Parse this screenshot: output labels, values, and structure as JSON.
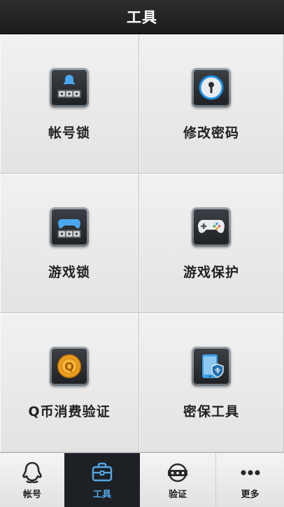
{
  "header": {
    "title": "工具"
  },
  "tools": [
    {
      "label": "帐号锁",
      "icon": "account-lock-icon"
    },
    {
      "label": "修改密码",
      "icon": "change-password-icon"
    },
    {
      "label": "游戏锁",
      "icon": "game-lock-icon"
    },
    {
      "label": "游戏保护",
      "icon": "game-protect-icon"
    },
    {
      "label": "Q币消费验证",
      "icon": "qcoin-verify-icon"
    },
    {
      "label": "密保工具",
      "icon": "security-tool-icon"
    }
  ],
  "tabs": [
    {
      "label": "帐号",
      "icon": "penguin-icon",
      "active": false
    },
    {
      "label": "工具",
      "icon": "toolbox-icon",
      "active": true
    },
    {
      "label": "验证",
      "icon": "verify-icon",
      "active": false
    },
    {
      "label": "更多",
      "icon": "more-dots-icon",
      "active": false
    }
  ],
  "colors": {
    "header_bg": "#1c1c1c",
    "active_tab_bg": "#1d2126",
    "accent_blue": "#53a8e6",
    "accent_orange": "#f0a020"
  }
}
